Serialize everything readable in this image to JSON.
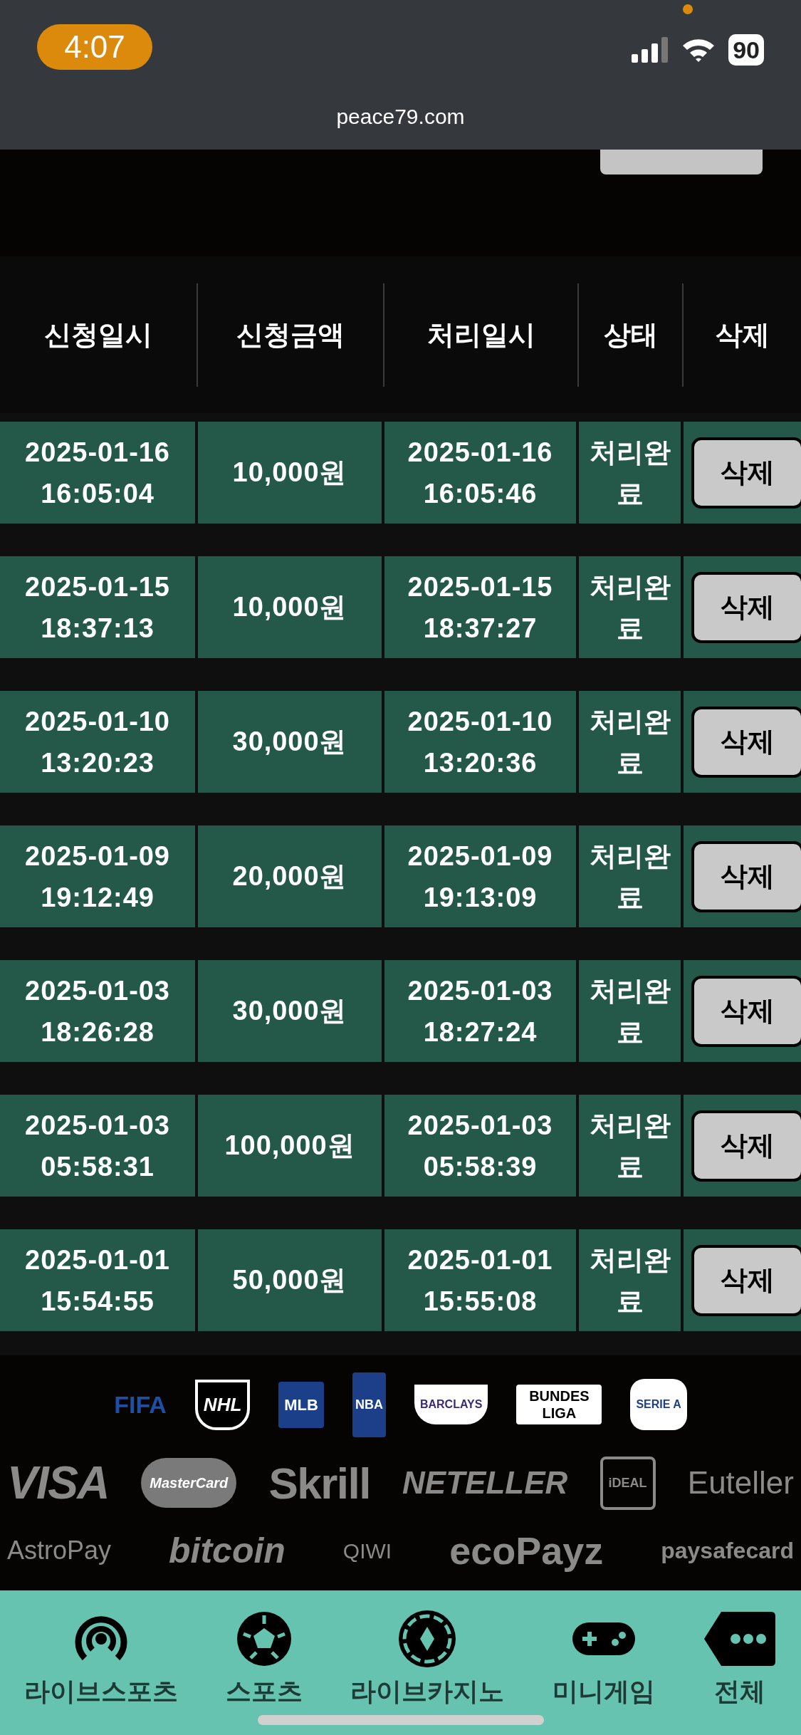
{
  "status_bar": {
    "time": "4:07",
    "battery": "90"
  },
  "browser": {
    "url": "peace79.com"
  },
  "table": {
    "columns": [
      "신청일시",
      "신청금액",
      "처리일시",
      "상태",
      "삭제"
    ],
    "rows": [
      {
        "requested": [
          "2025-01-16",
          "16:05:04"
        ],
        "amount": "10,000원",
        "processed": [
          "2025-01-16",
          "16:05:46"
        ],
        "status": "처리완료",
        "action": "삭제"
      },
      {
        "requested": [
          "2025-01-15",
          "18:37:13"
        ],
        "amount": "10,000원",
        "processed": [
          "2025-01-15",
          "18:37:27"
        ],
        "status": "처리완료",
        "action": "삭제"
      },
      {
        "requested": [
          "2025-01-10",
          "13:20:23"
        ],
        "amount": "30,000원",
        "processed": [
          "2025-01-10",
          "13:20:36"
        ],
        "status": "처리완료",
        "action": "삭제"
      },
      {
        "requested": [
          "2025-01-09",
          "19:12:49"
        ],
        "amount": "20,000원",
        "processed": [
          "2025-01-09",
          "19:13:09"
        ],
        "status": "처리완료",
        "action": "삭제"
      },
      {
        "requested": [
          "2025-01-03",
          "18:26:28"
        ],
        "amount": "30,000원",
        "processed": [
          "2025-01-03",
          "18:27:24"
        ],
        "status": "처리완료",
        "action": "삭제"
      },
      {
        "requested": [
          "2025-01-03",
          "05:58:31"
        ],
        "amount": "100,000원",
        "processed": [
          "2025-01-03",
          "05:58:39"
        ],
        "status": "처리완료",
        "action": "삭제"
      },
      {
        "requested": [
          "2025-01-01",
          "15:54:55"
        ],
        "amount": "50,000원",
        "processed": [
          "2025-01-01",
          "15:55:08"
        ],
        "status": "처리완료",
        "action": "삭제"
      }
    ]
  },
  "league_logos": [
    "FIFA",
    "NHL",
    "MLB",
    "NBA",
    "BARCLAYS",
    "BUNDES LIGA",
    "SERIE A"
  ],
  "payment_logos_top": [
    "VISA",
    "MasterCard",
    "Skrill",
    "NETELLER",
    "iDEAL",
    "Euteller"
  ],
  "payment_logos_bottom": [
    "AstroPay",
    "bitcoin",
    "QIWI",
    "ecoPayz",
    "paysafecard"
  ],
  "bottom_nav": [
    {
      "label": "라이브스포츠"
    },
    {
      "label": "스포츠"
    },
    {
      "label": "라이브카지노"
    },
    {
      "label": "미니게임"
    },
    {
      "label": "전체"
    }
  ]
}
